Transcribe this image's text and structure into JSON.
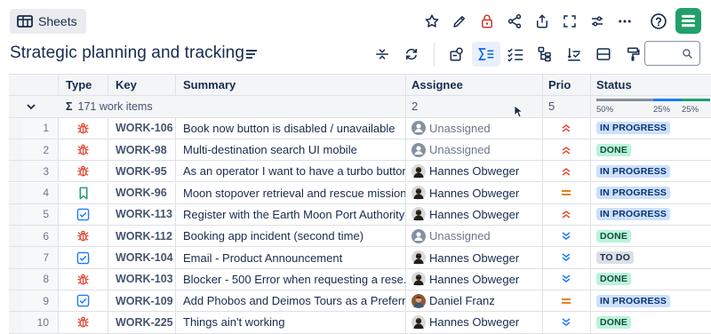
{
  "header": {
    "sheets_label": "Sheets",
    "title": "Strategic planning and tracking",
    "top_icons": [
      "star-icon",
      "pencil-icon",
      "lock-icon",
      "share-icon",
      "export-icon",
      "fullscreen-icon",
      "settings-sliders-icon",
      "more-icon",
      "help-icon",
      "app-logo-icon"
    ],
    "toolbar_icons": [
      "collapse-icon",
      "refresh-icon",
      "issue-view-icon",
      "sum-icon",
      "checklist-icon",
      "hierarchy-icon",
      "sort-icon",
      "row-height-icon",
      "format-painter-icon"
    ],
    "search": {
      "value": "",
      "placeholder": ""
    }
  },
  "columns": [
    "Type",
    "Key",
    "Summary",
    "Assignee",
    "Prio",
    "Status"
  ],
  "summary_row": {
    "sigma": "Σ",
    "total_text": "171 work items",
    "assignee_count": "2",
    "prio_count": "5",
    "status_distribution": [
      {
        "label": "50%",
        "fraction": 0.5,
        "color": "#8590a2"
      },
      {
        "label": "25%",
        "fraction": 0.25,
        "color": "#1d7afc"
      },
      {
        "label": "25%",
        "fraction": 0.25,
        "color": "#22a06b"
      }
    ]
  },
  "rows": [
    {
      "num": "1",
      "type": "bug",
      "key": "WORK-106",
      "summary": "Book now button is disabled / unavailable",
      "assignee": "Unassigned",
      "assigned": false,
      "prio": "high",
      "status": "IN PROGRESS",
      "status_kind": "inprogress"
    },
    {
      "num": "2",
      "type": "bug",
      "key": "WORK-98",
      "summary": "Multi-destination search UI mobile",
      "assignee": "Unassigned",
      "assigned": false,
      "prio": "high",
      "status": "DONE",
      "status_kind": "done"
    },
    {
      "num": "3",
      "type": "bug",
      "key": "WORK-95",
      "summary": "As an operator I want to have a turbo button",
      "assignee": "Hannes Obweger",
      "assigned": true,
      "avatar": "hannes",
      "prio": "high",
      "status": "IN PROGRESS",
      "status_kind": "inprogress"
    },
    {
      "num": "4",
      "type": "story",
      "key": "WORK-96",
      "summary": "Moon stopover retrieval and rescue mission...",
      "assignee": "Hannes Obweger",
      "assigned": true,
      "avatar": "hannes",
      "prio": "medium",
      "status": "IN PROGRESS",
      "status_kind": "inprogress"
    },
    {
      "num": "5",
      "type": "task",
      "key": "WORK-113",
      "summary": "Register with the Earth Moon Port Authority",
      "assignee": "Hannes Obweger",
      "assigned": true,
      "avatar": "hannes",
      "prio": "high",
      "status": "IN PROGRESS",
      "status_kind": "inprogress"
    },
    {
      "num": "6",
      "type": "bug",
      "key": "WORK-112",
      "summary": "Booking app incident (second time)",
      "assignee": "Unassigned",
      "assigned": false,
      "prio": "low",
      "status": "DONE",
      "status_kind": "done"
    },
    {
      "num": "7",
      "type": "task",
      "key": "WORK-104",
      "summary": "Email - Product Announcement",
      "assignee": "Hannes Obweger",
      "assigned": true,
      "avatar": "hannes",
      "prio": "low",
      "status": "TO DO",
      "status_kind": "todo"
    },
    {
      "num": "8",
      "type": "bug",
      "key": "WORK-103",
      "summary": "Blocker - 500 Error when requesting a rese...",
      "assignee": "Hannes Obweger",
      "assigned": true,
      "avatar": "hannes",
      "prio": "low",
      "status": "DONE",
      "status_kind": "done"
    },
    {
      "num": "9",
      "type": "task",
      "key": "WORK-109",
      "summary": "Add Phobos and Deimos Tours as a Preferr...",
      "assignee": "Daniel Franz",
      "assigned": true,
      "avatar": "daniel",
      "prio": "medium",
      "status": "IN PROGRESS",
      "status_kind": "inprogress"
    },
    {
      "num": "10",
      "type": "bug",
      "key": "WORK-225",
      "summary": "Things ain't working",
      "assignee": "Hannes Obweger",
      "assigned": true,
      "avatar": "hannes",
      "prio": "low",
      "status": "DONE",
      "status_kind": "done"
    }
  ],
  "colors": {
    "bug": "#e34935",
    "story": "#22a06b",
    "task": "#1d7afc",
    "prio_high": "#e34935",
    "prio_medium": "#e06c00",
    "prio_low": "#1d7afc",
    "logo": "#22a06b",
    "lock": "#c9372c"
  }
}
